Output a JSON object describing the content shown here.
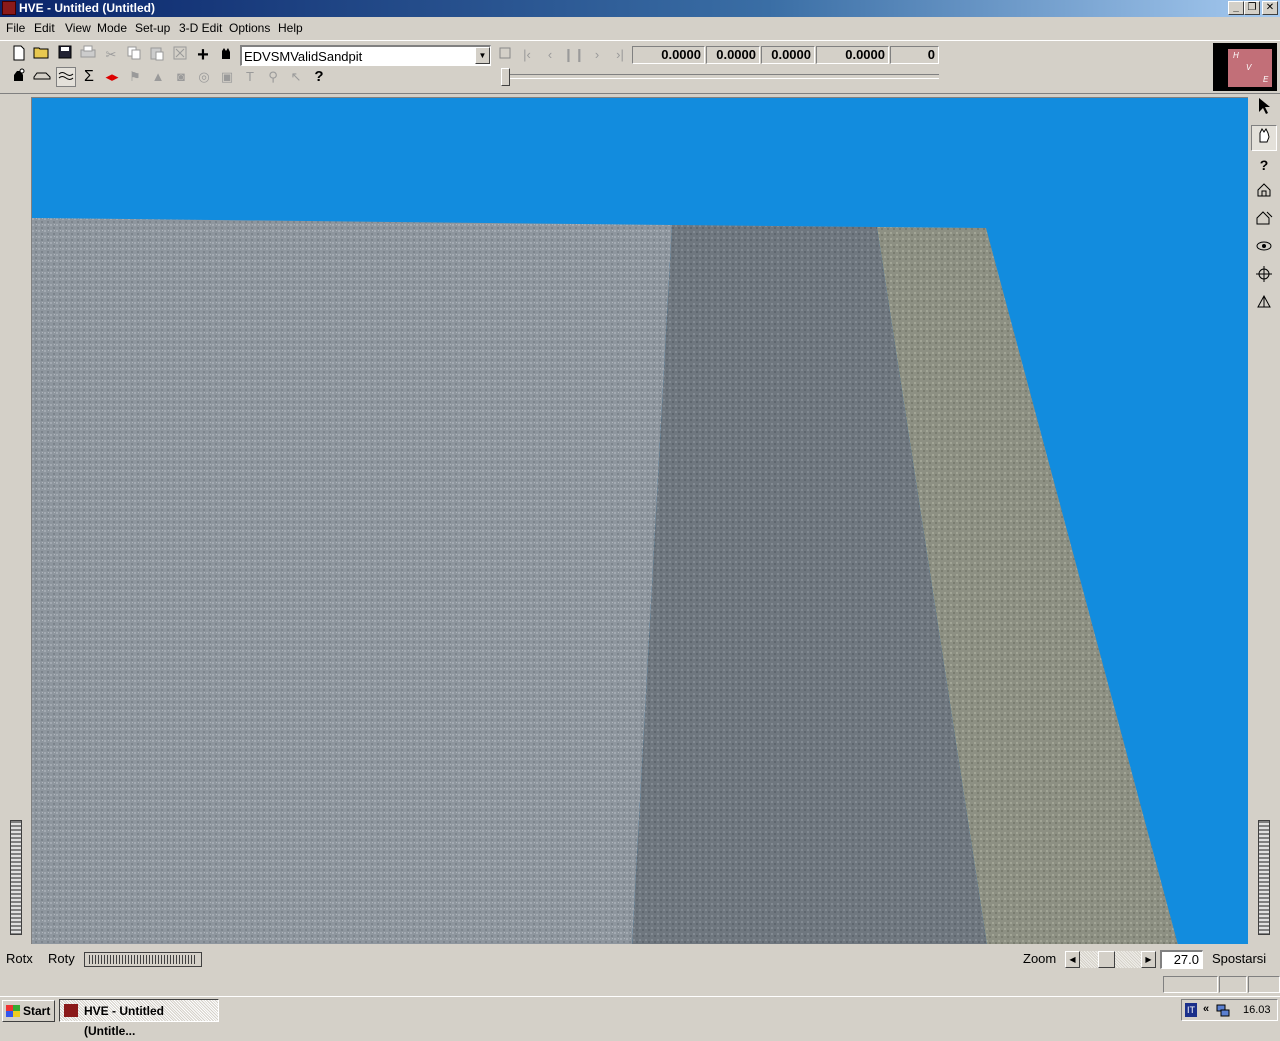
{
  "window": {
    "title": "HVE - Untitled (Untitled)",
    "controls": {
      "minimize": "_",
      "restore": "❐",
      "close": "✕"
    }
  },
  "menu": {
    "items": [
      "File",
      "Edit",
      "View",
      "Mode",
      "Set-up",
      "3-D Edit",
      "Options",
      "Help"
    ]
  },
  "toolbar": {
    "model_select": "EDVSMValidSandpit",
    "values": {
      "v1": "0.0000",
      "v2": "0.0000",
      "v3": "0.0000",
      "v4": "0.0000",
      "frame": "0"
    },
    "help_glyph": "?"
  },
  "logo": {
    "letters": [
      "H",
      "V",
      "E"
    ]
  },
  "scene": {
    "sky_color": "#128cde",
    "surface_colors": {
      "left": "#8f979e",
      "middle": "#707880",
      "right": "#8e9184"
    }
  },
  "right_toolbar": {
    "help_glyph": "?"
  },
  "status": {
    "rotx_label": "Rotx",
    "roty_label": "Roty",
    "zoom_label": "Zoom",
    "zoom_value": "27.0",
    "mode_label": "Spostarsi"
  },
  "taskbar": {
    "start_label": "Start",
    "task_label": "HVE - Untitled (Untitle...",
    "tray_lang": "IT",
    "tray_chevron": "«",
    "clock": "16.03"
  }
}
